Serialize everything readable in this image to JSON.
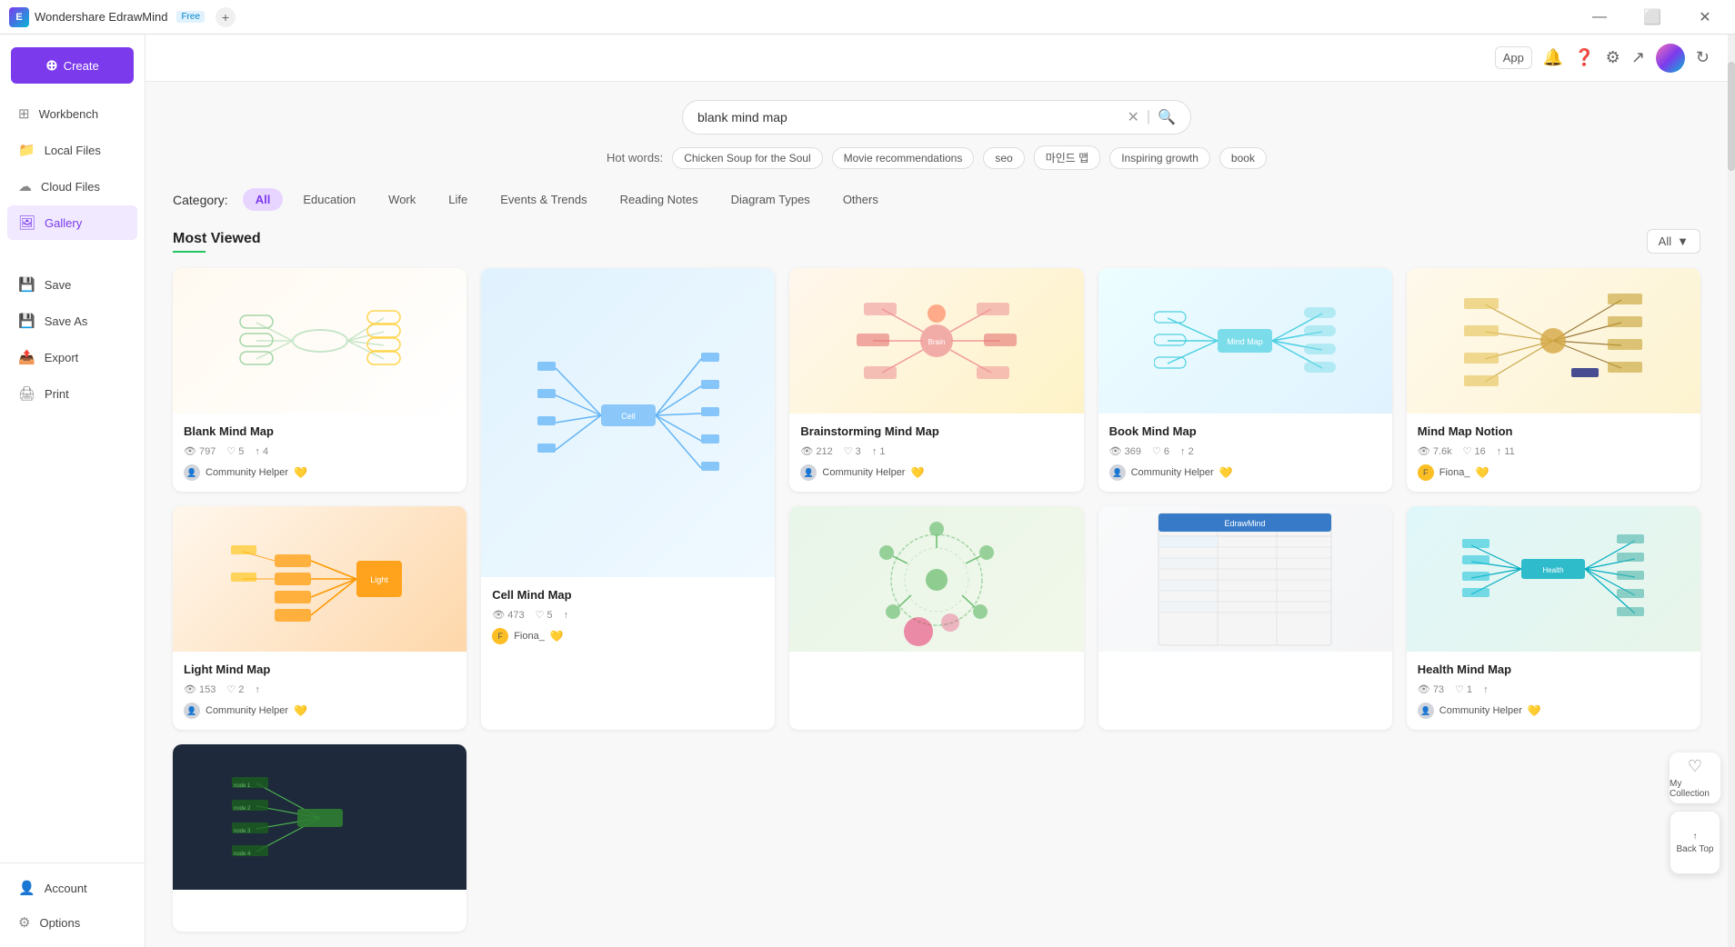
{
  "titlebar": {
    "app_name": "Wondershare EdrawMind",
    "badge": "Free",
    "tab_plus": "+"
  },
  "top_bar_actions": {
    "app_label": "App",
    "avatar_alt": "user avatar",
    "refresh_title": "Refresh"
  },
  "sidebar": {
    "create_label": "Create",
    "nav_items": [
      {
        "id": "workbench",
        "label": "Workbench",
        "icon": "⊞"
      },
      {
        "id": "local-files",
        "label": "Local Files",
        "icon": "📁"
      },
      {
        "id": "cloud-files",
        "label": "Cloud Files",
        "icon": "☁"
      },
      {
        "id": "gallery",
        "label": "Gallery",
        "icon": "🖼"
      }
    ],
    "bottom_items": [
      {
        "id": "save",
        "label": "Save",
        "icon": "💾"
      },
      {
        "id": "save-as",
        "label": "Save As",
        "icon": "💾"
      },
      {
        "id": "export",
        "label": "Export",
        "icon": "📤"
      },
      {
        "id": "print",
        "label": "Print",
        "icon": "🖨"
      }
    ],
    "account_label": "Account",
    "options_label": "Options"
  },
  "search": {
    "value": "blank mind map",
    "placeholder": "blank mind map",
    "hot_label": "Hot words:",
    "hot_tags": [
      "Chicken Soup for the Soul",
      "Movie recommendations",
      "seo",
      "마인드 맵",
      "Inspiring growth",
      "book"
    ]
  },
  "category": {
    "label": "Category:",
    "tabs": [
      {
        "id": "all",
        "label": "All",
        "active": true
      },
      {
        "id": "education",
        "label": "Education"
      },
      {
        "id": "work",
        "label": "Work"
      },
      {
        "id": "life",
        "label": "Life"
      },
      {
        "id": "events",
        "label": "Events & Trends"
      },
      {
        "id": "reading-notes",
        "label": "Reading Notes"
      },
      {
        "id": "diagram-types",
        "label": "Diagram Types"
      },
      {
        "id": "others",
        "label": "Others"
      }
    ]
  },
  "section": {
    "title": "Most Viewed",
    "filter_label": "All",
    "filter_icon": "▼"
  },
  "cards": [
    {
      "id": "blank-mind-map",
      "title": "Blank Mind Map",
      "views": "797",
      "likes": "5",
      "shares": "4",
      "author": "Community Helper",
      "author_verified": true,
      "thumb_type": "blank"
    },
    {
      "id": "cell-mind-map",
      "title": "Cell Mind Map",
      "views": "473",
      "likes": "5",
      "shares": "",
      "author": "Fiona_",
      "author_verified": true,
      "thumb_type": "blue",
      "tall": true
    },
    {
      "id": "brainstorming-mind-map",
      "title": "Brainstorming Mind Map",
      "views": "212",
      "likes": "3",
      "shares": "1",
      "author": "Community Helper",
      "author_verified": true,
      "thumb_type": "warm"
    },
    {
      "id": "book-mind-map",
      "title": "Book Mind Map",
      "views": "369",
      "likes": "6",
      "shares": "2",
      "author": "Community Helper",
      "author_verified": true,
      "thumb_type": "teal"
    },
    {
      "id": "mind-map-notion",
      "title": "Mind Map Notion",
      "views": "7.6k",
      "likes": "16",
      "shares": "11",
      "author": "Fiona_",
      "author_verified": true,
      "thumb_type": "warm_light"
    },
    {
      "id": "light-mind-map",
      "title": "Light Mind Map",
      "views": "153",
      "likes": "2",
      "shares": "",
      "author": "Community Helper",
      "author_verified": true,
      "thumb_type": "orange"
    },
    {
      "id": "card-placeholder-2",
      "title": "",
      "views": "",
      "likes": "",
      "shares": "",
      "author": "",
      "thumb_type": "blue_light",
      "tall": false,
      "placeholder": true
    },
    {
      "id": "community-card",
      "title": "",
      "views": "",
      "likes": "",
      "shares": "",
      "author": "",
      "thumb_type": "green",
      "placeholder": true
    },
    {
      "id": "edrawmind-card",
      "title": "",
      "views": "",
      "likes": "",
      "shares": "",
      "author": "",
      "thumb_type": "gray",
      "placeholder": true
    },
    {
      "id": "health-mind-map",
      "title": "Health Mind Map",
      "views": "73",
      "likes": "1",
      "shares": "",
      "author": "Community Helper",
      "author_verified": true,
      "thumb_type": "teal2"
    },
    {
      "id": "dark-card",
      "title": "",
      "views": "",
      "likes": "",
      "shares": "",
      "author": "",
      "thumb_type": "dark",
      "placeholder": true
    }
  ],
  "floating": {
    "collection_icon": "♡",
    "collection_label": "My Collection",
    "back_top_icon": "↑",
    "back_top_label": "Back Top"
  }
}
